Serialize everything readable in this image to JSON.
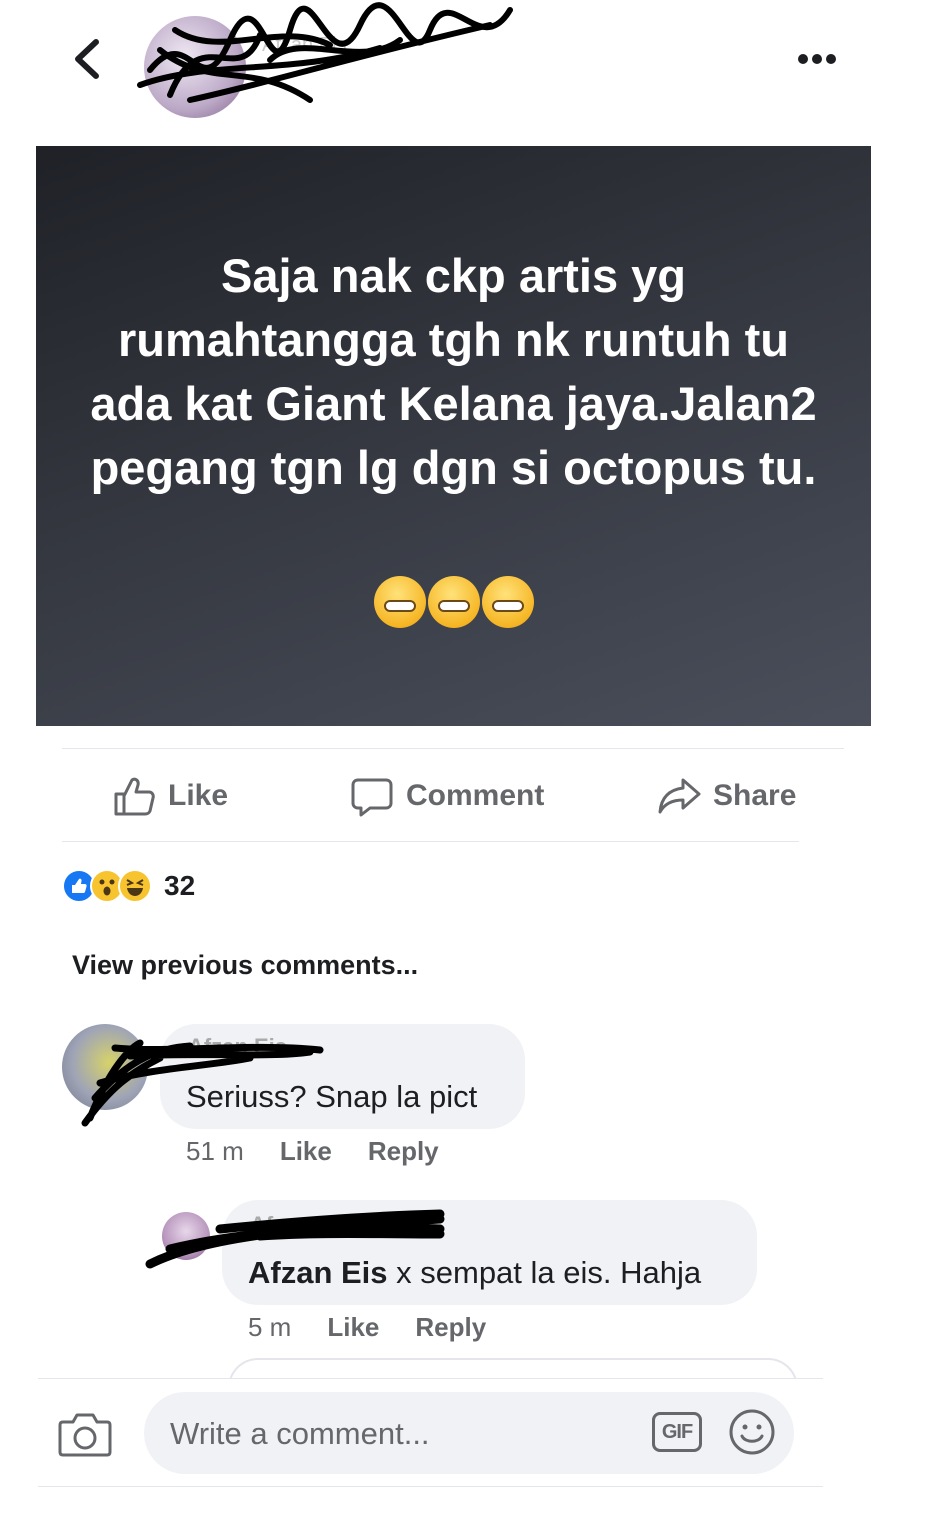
{
  "header": {
    "author_name": "Afzan Eis",
    "back_icon": "chevron-left-icon",
    "more_icon": "more-horizontal-icon"
  },
  "post": {
    "text": "Saja nak ckp artis yg rumahtangga tgh nk runtuh tu ada kat Giant Kelana jaya.Jalan2 pegang tgn lg dgn si octopus tu.",
    "emoji": [
      "grimacing-face",
      "grimacing-face",
      "grimacing-face"
    ],
    "background": "#2b2e35"
  },
  "actions": {
    "like": "Like",
    "comment": "Comment",
    "share": "Share"
  },
  "reactions": {
    "types": [
      "like",
      "wow",
      "haha"
    ],
    "count": "32"
  },
  "comments_section": {
    "view_previous": "View previous comments..."
  },
  "comments": [
    {
      "author": "Afzan Eis",
      "text": "Seriuss? Snap la pict",
      "time": "51 m",
      "like": "Like",
      "reply": "Reply"
    },
    {
      "author": "Afzan Eis",
      "mention": "Afzan Eis",
      "text": " x sempat la eis. Hahja",
      "time": "5 m",
      "like": "Like",
      "reply": "Reply"
    }
  ],
  "composer": {
    "placeholder": "Write a comment...",
    "gif_label": "GIF"
  },
  "colors": {
    "meta_grey": "#65676b",
    "bubble": "#f0f2f5",
    "like_blue": "#1877f2"
  }
}
